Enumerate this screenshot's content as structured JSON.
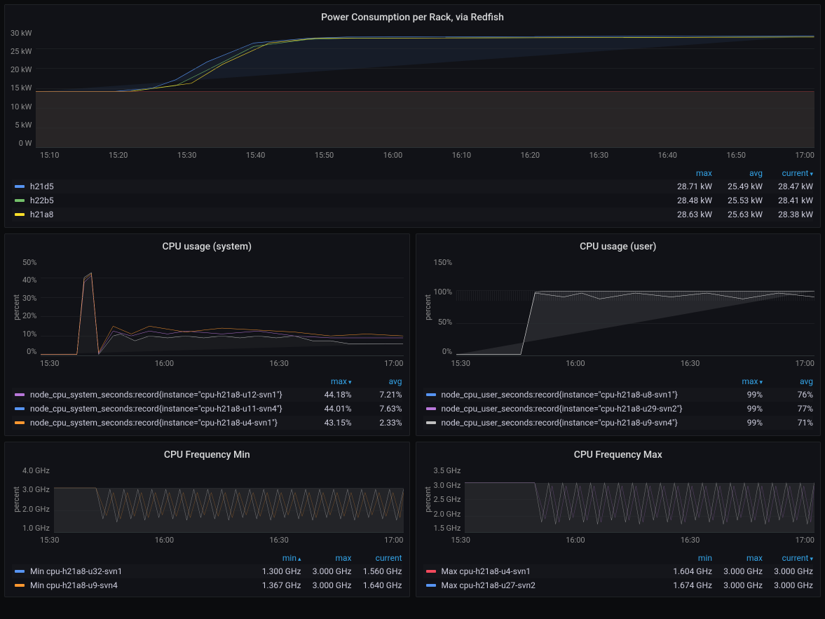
{
  "chart_data": [
    {
      "type": "line",
      "title": "Power Consumption per Rack, via Redfish",
      "ylabel": "",
      "ylim": [
        0,
        30
      ],
      "yticks": [
        "30 kW",
        "25 kW",
        "20 kW",
        "15 kW",
        "10 kW",
        "5 kW",
        "0 W"
      ],
      "xticks": [
        "15:10",
        "15:20",
        "15:30",
        "15:40",
        "15:50",
        "16:00",
        "16:10",
        "16:20",
        "16:30",
        "16:40",
        "16:50",
        "17:00"
      ],
      "legend_cols": [
        "max",
        "avg",
        "current"
      ],
      "sort_col": "current",
      "sort_dir": "desc",
      "series": [
        {
          "name": "h21d5",
          "color": "#5794F2",
          "max": "28.71 kW",
          "avg": "25.49 kW",
          "current": "28.47 kW"
        },
        {
          "name": "h22b5",
          "color": "#73BF69",
          "max": "28.48 kW",
          "avg": "25.53 kW",
          "current": "28.41 kW"
        },
        {
          "name": "h21a8",
          "color": "#FADE2A",
          "max": "28.63 kW",
          "avg": "25.63 kW",
          "current": "28.38 kW"
        }
      ]
    },
    {
      "type": "line",
      "title": "CPU usage (system)",
      "ylabel": "percent",
      "ylim": [
        0,
        50
      ],
      "yticks": [
        "50%",
        "40%",
        "30%",
        "20%",
        "10%",
        "0%"
      ],
      "xticks": [
        "15:30",
        "16:00",
        "16:30",
        "17:00"
      ],
      "legend_cols": [
        "max",
        "avg"
      ],
      "sort_col": "max",
      "sort_dir": "desc",
      "series": [
        {
          "name": "node_cpu_system_seconds:record{instance=\"cpu-h21a8-u12-svn1\"}",
          "color": "#B877D9",
          "max": "44.18%",
          "avg": "7.21%"
        },
        {
          "name": "node_cpu_system_seconds:record{instance=\"cpu-h21a8-u11-svn4\"}",
          "color": "#5794F2",
          "max": "44.01%",
          "avg": "7.63%"
        },
        {
          "name": "node_cpu_system_seconds:record{instance=\"cpu-h21a8-u4-svn1\"}",
          "color": "#FF9830",
          "max": "43.15%",
          "avg": "2.33%"
        }
      ]
    },
    {
      "type": "line",
      "title": "CPU usage (user)",
      "ylabel": "percent",
      "ylim": [
        0,
        150
      ],
      "yticks": [
        "150%",
        "100%",
        "50%",
        "0%"
      ],
      "xticks": [
        "15:30",
        "16:00",
        "16:30",
        "17:00"
      ],
      "legend_cols": [
        "max",
        "avg"
      ],
      "sort_col": "max",
      "sort_dir": "desc",
      "series": [
        {
          "name": "node_cpu_user_seconds:record{instance=\"cpu-h21a8-u8-svn1\"}",
          "color": "#5794F2",
          "max": "99%",
          "avg": "76%"
        },
        {
          "name": "node_cpu_user_seconds:record{instance=\"cpu-h21a8-u29-svn2\"}",
          "color": "#B877D9",
          "max": "99%",
          "avg": "77%"
        },
        {
          "name": "node_cpu_user_seconds:record{instance=\"cpu-h21a8-u9-svn4\"}",
          "color": "#C0C0C0",
          "max": "99%",
          "avg": "71%"
        }
      ]
    },
    {
      "type": "line",
      "title": "CPU Frequency Min",
      "ylabel": "percent",
      "ylim": [
        1.0,
        4.0
      ],
      "yticks": [
        "4.0 GHz",
        "3.0 GHz",
        "2.0 GHz",
        "1.0 GHz"
      ],
      "xticks": [
        "15:30",
        "16:00",
        "16:30",
        "17:00"
      ],
      "legend_cols": [
        "min",
        "max",
        "current"
      ],
      "sort_col": "min",
      "sort_dir": "asc",
      "series": [
        {
          "name": "Min cpu-h21a8-u32-svn1",
          "color": "#5794F2",
          "min": "1.300 GHz",
          "max": "3.000 GHz",
          "current": "1.560 GHz"
        },
        {
          "name": "Min cpu-h21a8-u9-svn4",
          "color": "#FF9830",
          "min": "1.367 GHz",
          "max": "3.000 GHz",
          "current": "1.640 GHz"
        }
      ]
    },
    {
      "type": "line",
      "title": "CPU Frequency Max",
      "ylabel": "percent",
      "ylim": [
        1.5,
        3.5
      ],
      "yticks": [
        "3.5 GHz",
        "3.0 GHz",
        "2.5 GHz",
        "2.0 GHz",
        "1.5 GHz"
      ],
      "xticks": [
        "15:30",
        "16:00",
        "16:30",
        "17:00"
      ],
      "legend_cols": [
        "min",
        "max",
        "current"
      ],
      "sort_col": "current",
      "sort_dir": "desc",
      "series": [
        {
          "name": "Max cpu-h21a8-u4-svn1",
          "color": "#F2495C",
          "min": "1.604 GHz",
          "max": "3.000 GHz",
          "current": "3.000 GHz"
        },
        {
          "name": "Max cpu-h21a8-u27-svn2",
          "color": "#5794F2",
          "min": "1.674 GHz",
          "max": "3.000 GHz",
          "current": "3.000 GHz"
        }
      ]
    }
  ]
}
